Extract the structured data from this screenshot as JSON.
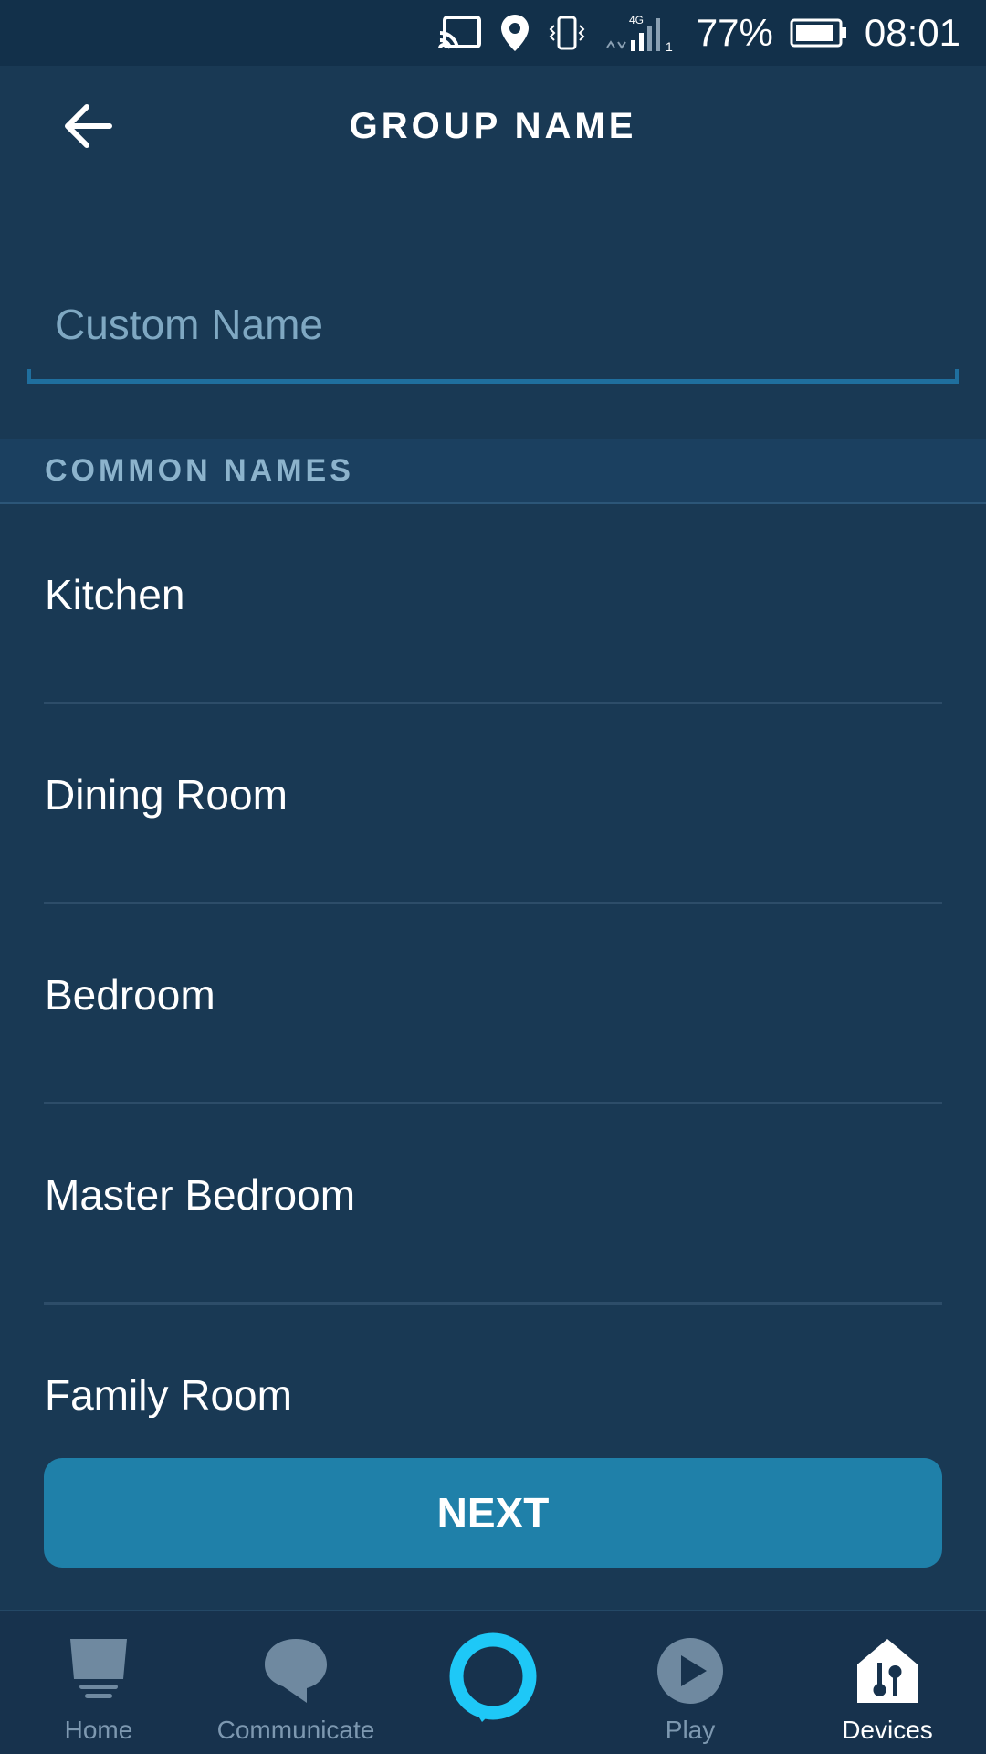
{
  "status_bar": {
    "battery_percent": "77%",
    "time": "08:01",
    "network": "4G",
    "sim_slot": "1",
    "icons": [
      "cast-icon",
      "location-icon",
      "vibrate-icon",
      "signal-icon",
      "battery-icon"
    ]
  },
  "header": {
    "title": "GROUP NAME",
    "back_icon": "arrow-left-icon"
  },
  "custom_name": {
    "placeholder": "Custom Name",
    "value": ""
  },
  "section": {
    "title": "COMMON NAMES"
  },
  "common_names": [
    {
      "label": "Kitchen"
    },
    {
      "label": "Dining Room"
    },
    {
      "label": "Bedroom"
    },
    {
      "label": "Master Bedroom"
    },
    {
      "label": "Family Room"
    }
  ],
  "next_button": {
    "label": "NEXT"
  },
  "bottom_nav": {
    "items": [
      {
        "label": "Home",
        "icon": "home-icon"
      },
      {
        "label": "Communicate",
        "icon": "chat-bubble-icon"
      },
      {
        "label": "",
        "icon": "alexa-ring-icon"
      },
      {
        "label": "Play",
        "icon": "play-icon"
      },
      {
        "label": "Devices",
        "icon": "devices-icon",
        "active": true
      }
    ]
  },
  "colors": {
    "background": "#193954",
    "status_bar": "#12304a",
    "accent_button": "#1f80a9",
    "alexa_ring": "#1ec8f7",
    "placeholder_text": "#7fa8c2",
    "section_text": "#8cb3cc"
  }
}
